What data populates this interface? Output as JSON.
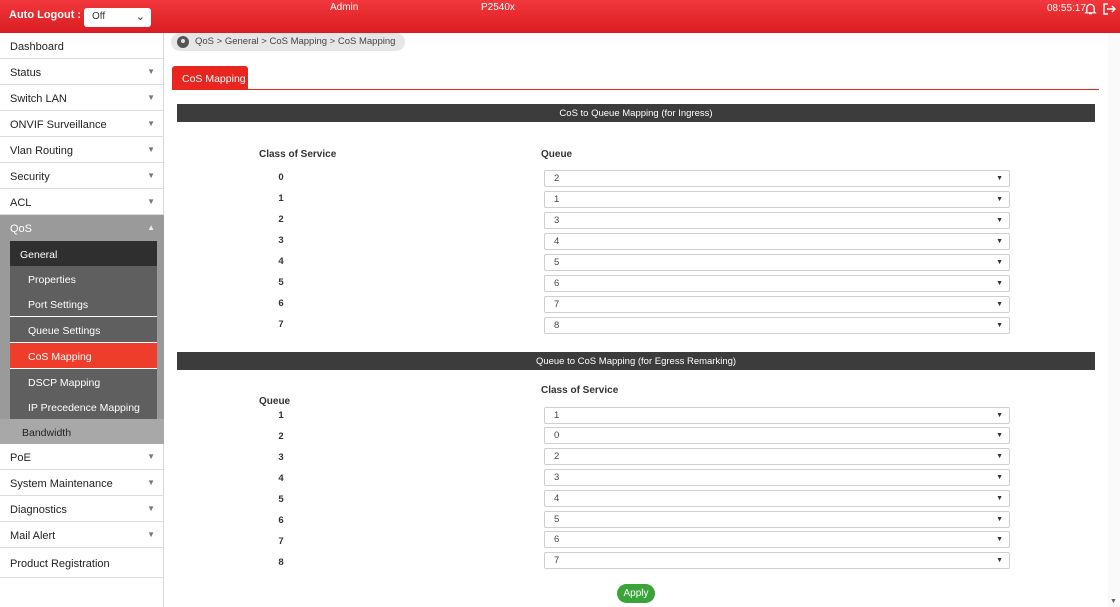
{
  "topbar": {
    "auto_logout_label": "Auto Logout :",
    "auto_logout_value": "Off",
    "user": "Admin",
    "model": "P2540x",
    "time": "08:55:17",
    "icons": [
      "bell-icon",
      "logout-icon"
    ],
    "color": "#e8251f"
  },
  "sidebar": {
    "items": [
      {
        "label": "Dashboard"
      },
      {
        "label": "Status"
      },
      {
        "label": "Switch LAN"
      },
      {
        "label": "ONVIF Surveillance"
      },
      {
        "label": "Vlan Routing"
      },
      {
        "label": "Security"
      },
      {
        "label": "ACL"
      },
      {
        "label": "QoS"
      }
    ],
    "qos_sub": {
      "general": "General",
      "children": [
        "Properties",
        "Port Settings",
        "Queue Settings",
        "CoS Mapping",
        "DSCP Mapping",
        "IP Precedence Mapping"
      ],
      "active": "CoS Mapping",
      "bandwidth": "Bandwidth"
    },
    "items_after": [
      {
        "label": "PoE"
      },
      {
        "label": "System Maintenance"
      },
      {
        "label": "Diagnostics"
      },
      {
        "label": "Mail Alert"
      },
      {
        "label": "Product Registration"
      }
    ]
  },
  "breadcrumb": "QoS > General > CoS Mapping > CoS Mapping",
  "tab": "CoS Mapping",
  "ingress": {
    "title": "CoS to Queue Mapping (for Ingress)",
    "col1": "Class of Service",
    "col2": "Queue",
    "rows": [
      {
        "key": "0",
        "value": "2"
      },
      {
        "key": "1",
        "value": "1"
      },
      {
        "key": "2",
        "value": "3"
      },
      {
        "key": "3",
        "value": "4"
      },
      {
        "key": "4",
        "value": "5"
      },
      {
        "key": "5",
        "value": "6"
      },
      {
        "key": "6",
        "value": "7"
      },
      {
        "key": "7",
        "value": "8"
      }
    ]
  },
  "egress": {
    "title": "Queue to CoS Mapping (for Egress Remarking)",
    "col1": "Queue",
    "col2": "Class of Service",
    "rows": [
      {
        "key": "1",
        "value": "1"
      },
      {
        "key": "2",
        "value": "0"
      },
      {
        "key": "3",
        "value": "2"
      },
      {
        "key": "4",
        "value": "3"
      },
      {
        "key": "5",
        "value": "4"
      },
      {
        "key": "6",
        "value": "5"
      },
      {
        "key": "7",
        "value": "6"
      },
      {
        "key": "8",
        "value": "7"
      }
    ]
  },
  "apply_label": "Apply",
  "colors": {
    "accent": "#e8251f",
    "apply": "#3aa33a",
    "section": "#3c3c3c"
  }
}
